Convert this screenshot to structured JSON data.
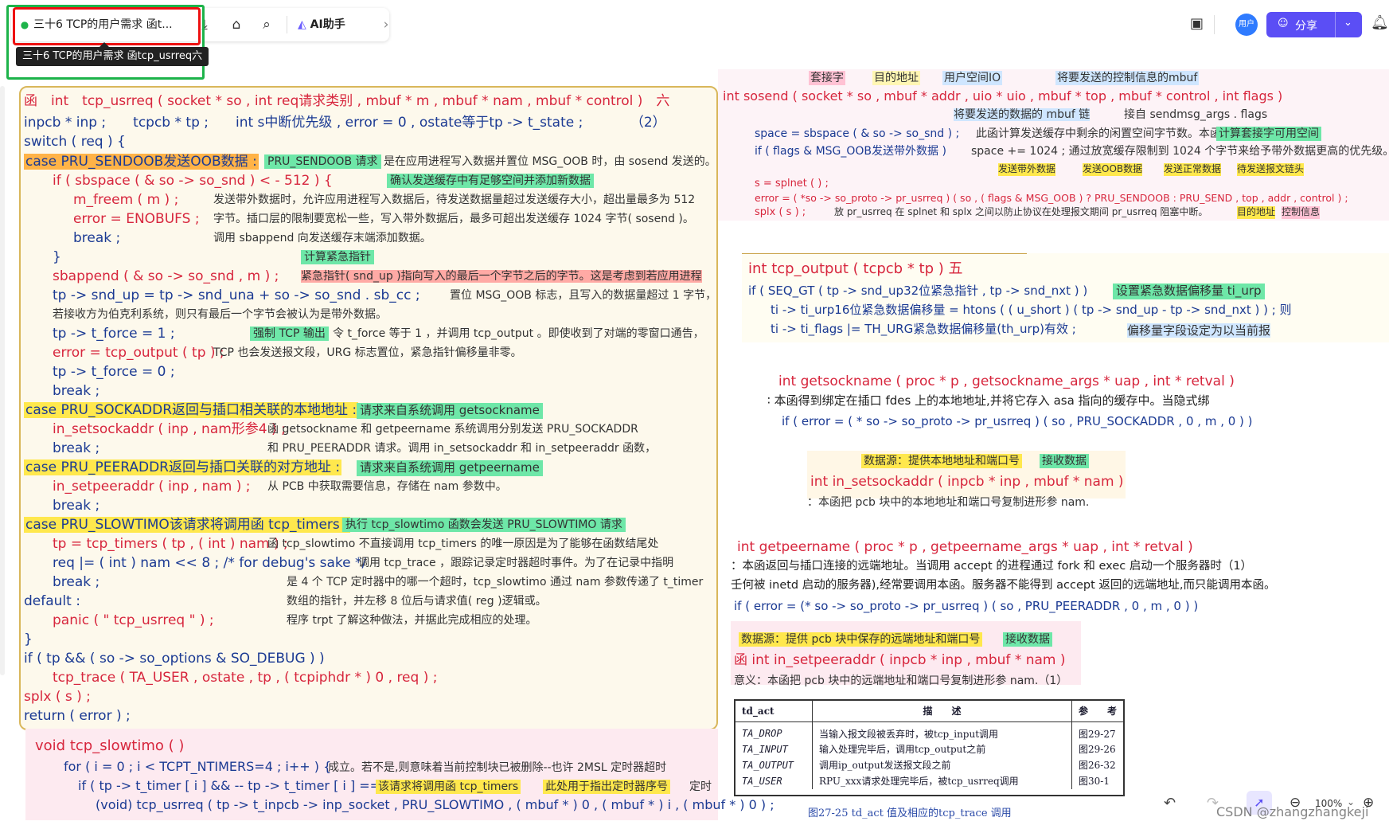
{
  "toolbar": {
    "tab_title": "三十6 TCP的用户需求 函t...",
    "tooltip": "三十6 TCP的用户需求 函tcp_usrreq六",
    "ai_label": "AI助手"
  },
  "rightbar": {
    "avatar_label": "用户",
    "share_label": "分享"
  },
  "left_panel": {
    "lines": [
      {
        "t": "函　int　tcp_usrreq ( socket * so , int req请求类别 , mbuf * m , mbuf * nam , mbuf *  control )　六"
      },
      {
        "t": "inpcb * inp ;　　tcpcb * tp ;　　int s中断优先级 , error = 0 , ostate等于tp -> t_state ;　　　　（2）"
      },
      {
        "t": "switch ( req ) {"
      },
      {
        "t": "case  PRU_SENDOOB发送OOB数据 :"
      },
      {
        "t": "if ( sbspace ( & so -> so_snd ) < - 512 ) {"
      },
      {
        "t": "m_freem ( m ) ;"
      },
      {
        "t": "error  =  ENOBUFS ;"
      },
      {
        "t": "break ;"
      },
      {
        "t": "}"
      },
      {
        "t": "sbappend ( & so -> so_snd , m ) ;"
      },
      {
        "t": "tp -> snd_up  =  tp -> snd_una  +  so -> so_snd . sb_cc ;"
      },
      {
        "t": "tp -> t_force   = 1 ;"
      },
      {
        "t": "error  =  tcp_output ( tp ) ;"
      },
      {
        "t": "tp -> t_force  = 0 ;"
      },
      {
        "t": "break ;"
      },
      {
        "t": "case   PRU_SOCKADDR返回与插口相关联的本地地址 :"
      },
      {
        "t": "in_setsockaddr ( inp , nam形参4 ) ;"
      },
      {
        "t": "break ;"
      },
      {
        "t": "case   PRU_PEERADDR返回与插口关联的对方地址 :"
      },
      {
        "t": "in_setpeeraddr ( inp , nam ) ;"
      },
      {
        "t": "break ;"
      },
      {
        "t": "case   PRU_SLOWTIMO该请求将调用函 tcp_timers :"
      },
      {
        "t": "tp  =  tcp_timers ( tp , ( int ) nam ) ;"
      },
      {
        "t": "req  |=  ( int ) nam  <<  8 ;    /* for debug's sake */"
      },
      {
        "t": "break ;"
      },
      {
        "t": "default :"
      },
      {
        "t": "panic ( \" tcp_usrreq \" ) ;"
      },
      {
        "t": "}"
      },
      {
        "t": "if ( tp  &&  ( so -> so_options  &  SO_DEBUG ) )"
      },
      {
        "t": "tcp_trace ( TA_USER , ostate , tp , ( tcpiphdr * ) 0 , req ) ;"
      },
      {
        "t": "splx ( s ) ;"
      },
      {
        "t": "return    ( error ) ;"
      }
    ],
    "notes": [
      "PRU_SENDOOB 请求",
      "是在应用进程写入数据并置位 MSG_OOB 时，由 sosend 发送的。",
      "确认发送缓存中有足够空间并添加新数据",
      "发送带外数据时，允许应用进程写入数据后，待发送数据量超过发送缓存大小，超出量最多为 512",
      "字节。插口层的限制要宽松一些，写入带外数据后，最多可超出发送缓存 1024 字节( sosend )。",
      "调用 sbappend 向发送缓存末端添加数据。",
      "计算紧急指针",
      "紧急指针( snd_up )指向写入的最后一个字节之后的字节。这是考虑到若应用进程",
      "置位 MSG_OOB 标志，且写入的数据量超过 1 字节，",
      "若接收方为伯克利系统，则只有最后一个字节会被认为是带外数据。",
      "强制 TCP 输出",
      "令 t_force 等于 1 ，并调用 tcp_output 。即使收到了对端的零窗口通告，",
      "TCP 也会发送报文段，URG 标志置位，紧急指针偏移量非零。",
      "请求来自系统调用 getsockname",
      "函 getsockname 和 getpeername 系统调用分别发送 PRU_SOCKADDR",
      "和 PRU_PEERADDR 请求。调用 in_setsockaddr 和 in_setpeeraddr 函数，",
      "请求来自系统调用 getpeername",
      "从 PCB 中获取需要信息，存储在 nam 参数中。",
      "执行 tcp_slowtimo 函数会发送 PRU_SLOWTIMO 请求",
      "函 tcp_slowtimo 不直接调用 tcp_timers 的唯一原因是为了能够在函数结尾处",
      "调用 tcp_trace ，跟踪记录定时器超时事件。为了在记录中指明",
      "是 4 个 TCP 定时器中的哪一个超时，tcp_slowtimo 通过 nam 参数传递了 t_timer",
      "数组的指针，并左移 8 位后与请求值( reg )逻辑或。",
      "程序  trpt 了解这种做法，并据此完成相应的处理。"
    ]
  },
  "slowtimo": {
    "lines": [
      "void   tcp_slowtimo ( )",
      "for ( i = 0 ; i  <  TCPT_NTIMERS=4 ; i++ ) {",
      "if ( tp -> t_timer [ i ]  &&  -- tp -> t_timer [ i ]  ==  0 )",
      "(void) tcp_usrreq ( tp -> t_inpcb -> inp_socket , PRU_SLOWTIMO , ( mbuf * ) 0 , ( mbuf * ) i , ( mbuf * ) 0 ) ;"
    ],
    "notes": [
      "成立。若不是,则意味着当前控制块已被删除--也许 2MSL 定时器超时",
      "该请求将调用函 tcp_timers",
      "此处用于指出定时器序号",
      "定时"
    ]
  },
  "sosend": {
    "top_labels": [
      "套接字",
      "目的地址",
      "用户空间IO",
      "将要发送的控制信息的mbuf"
    ],
    "signature": "int    sosend ( socket * so , mbuf * addr , uio * uio , mbuf * top , mbuf * control , int flags )",
    "sub_labels": [
      "将要发送的数据的 mbuf 链",
      "接自 sendmsg_args . flags"
    ],
    "line1": "space  =  sbspace ( & so -> so_snd ) ;",
    "line1_note": "此函计算发送缓存中剩余的闲置空间字节数。本函",
    "line1_tag": "计算套接字可用空间",
    "line2": "if ( flags  &  MSG_OOB发送带外数据 )",
    "line2_note": "space  +=  1024 ;   通过放宽缓存限制到 1024 个字节来给予带外数据更高的优先级。",
    "labels2": [
      "发送带外数据",
      "发送OOB数据",
      "发送正常数据",
      "待发送报文链头"
    ],
    "line3": "s  =  splnet ( ) ;",
    "line4": "error  =  ( *so -> so_proto -> pr_usrreq ) ( so , ( flags  &  MSG_OOB ) ?  PRU_SENDOOB  :  PRU_SEND , top , addr , control ) ;",
    "line5": "splx ( s ) ;",
    "line5_note": "放 pr_usrreq 在 splnet 和 splx 之间以防止协议在处理报文期间 pr_usrreq 阻塞中断。",
    "labels3": [
      "目的地址",
      "控制信息"
    ]
  },
  "tcp_output": {
    "signature": "int   tcp_output ( tcpcb * tp )        五",
    "line1": "if ( SEQ_GT ( tp -> snd_up32位紧急指针 , tp -> snd_nxt ) )",
    "line1_tag": "设置紧急数据偏移量 ti_urp",
    "line2": "ti -> ti_urp16位紧急数据偏移量  =  htons ( ( u_short ) ( tp -> snd_up  -  tp -> snd_nxt ) ) ;    则",
    "line3": "ti -> ti_flags  |=  TH_URG紧急数据偏移量(th_urp)有效 ;",
    "line3_note": "偏移量字段设定为以当前报"
  },
  "getsockname": {
    "signature": "int   getsockname ( proc * p , getsockname_args  * uap , int * retval )",
    "desc": "∶ 本函得到绑定在插口 fdes 上的本地地址,并将它存入 asa 指向的缓存中。当隐式绑",
    "line": "if ( error  =  ( * so -> so_proto -> pr_usrreq ) ( so , PRU_SOCKADDR , 0 , m , 0 ) )",
    "src_label": "数据源：提供本地地址和端口号",
    "recv_label": "接收数据",
    "setsock": "int   in_setsockaddr ( inpcb * inp , mbuf  * nam )",
    "setsock_desc": "：本函把 pcb 块中的本地地址和端口号复制进形参 nam."
  },
  "getpeername": {
    "signature": "int    getpeername ( proc * p , getpeername_args * uap , int * retval )",
    "desc1": "：本函返回与插口连接的远端地址。当调用 accept 的进程通过 fork 和 exec 启动一个服务器时（1）",
    "desc2": "壬何被 inetd 启动的服务器),经常要调用本函。服务器不能得到 accept 返回的远端地址,而只能调用本函。",
    "line": "if ( error  =  (* so -> so_proto -> pr_usrreq ) ( so , PRU_PEERADDR , 0 , m , 0 ) )",
    "src_label": "数据源：提供 pcb 块中保存的远端地址和端口号",
    "recv_label": "接收数据",
    "setpeer": "函   int  in_setpeeraddr ( inpcb * inp , mbuf  * nam )",
    "setpeer_desc": "意义：本函把 pcb 块中的远端地址和端口号复制进形参 nam.（1）"
  },
  "table": {
    "headers": [
      "td_act",
      "描　　述",
      "参　　考"
    ],
    "rows": [
      [
        "TA_DROP",
        "当输入报文段被丢弃时，被tcp_input调用",
        "图29-27"
      ],
      [
        "TA_INPUT",
        "输入处理完毕后，调用tcp_output之前",
        "图29-26"
      ],
      [
        "TA_OUTPUT",
        "调用ip_output发送报文段之前",
        "图26-32"
      ],
      [
        "TA_USER",
        "RPU_xxx请求处理完毕后，被tcp_usrreq调用",
        "图30-1"
      ]
    ],
    "caption": "图27-25   td_act  值及相应的tcp_trace  调用"
  },
  "bottom": {
    "zoom": "100%",
    "watermark": "CSDN @zhangzhangkeji"
  },
  "colors": {
    "accent": "#5b4ef5",
    "red": "#d7263d",
    "code_blue": "#1b3a93",
    "panel_bg": "#fdf9ec"
  }
}
